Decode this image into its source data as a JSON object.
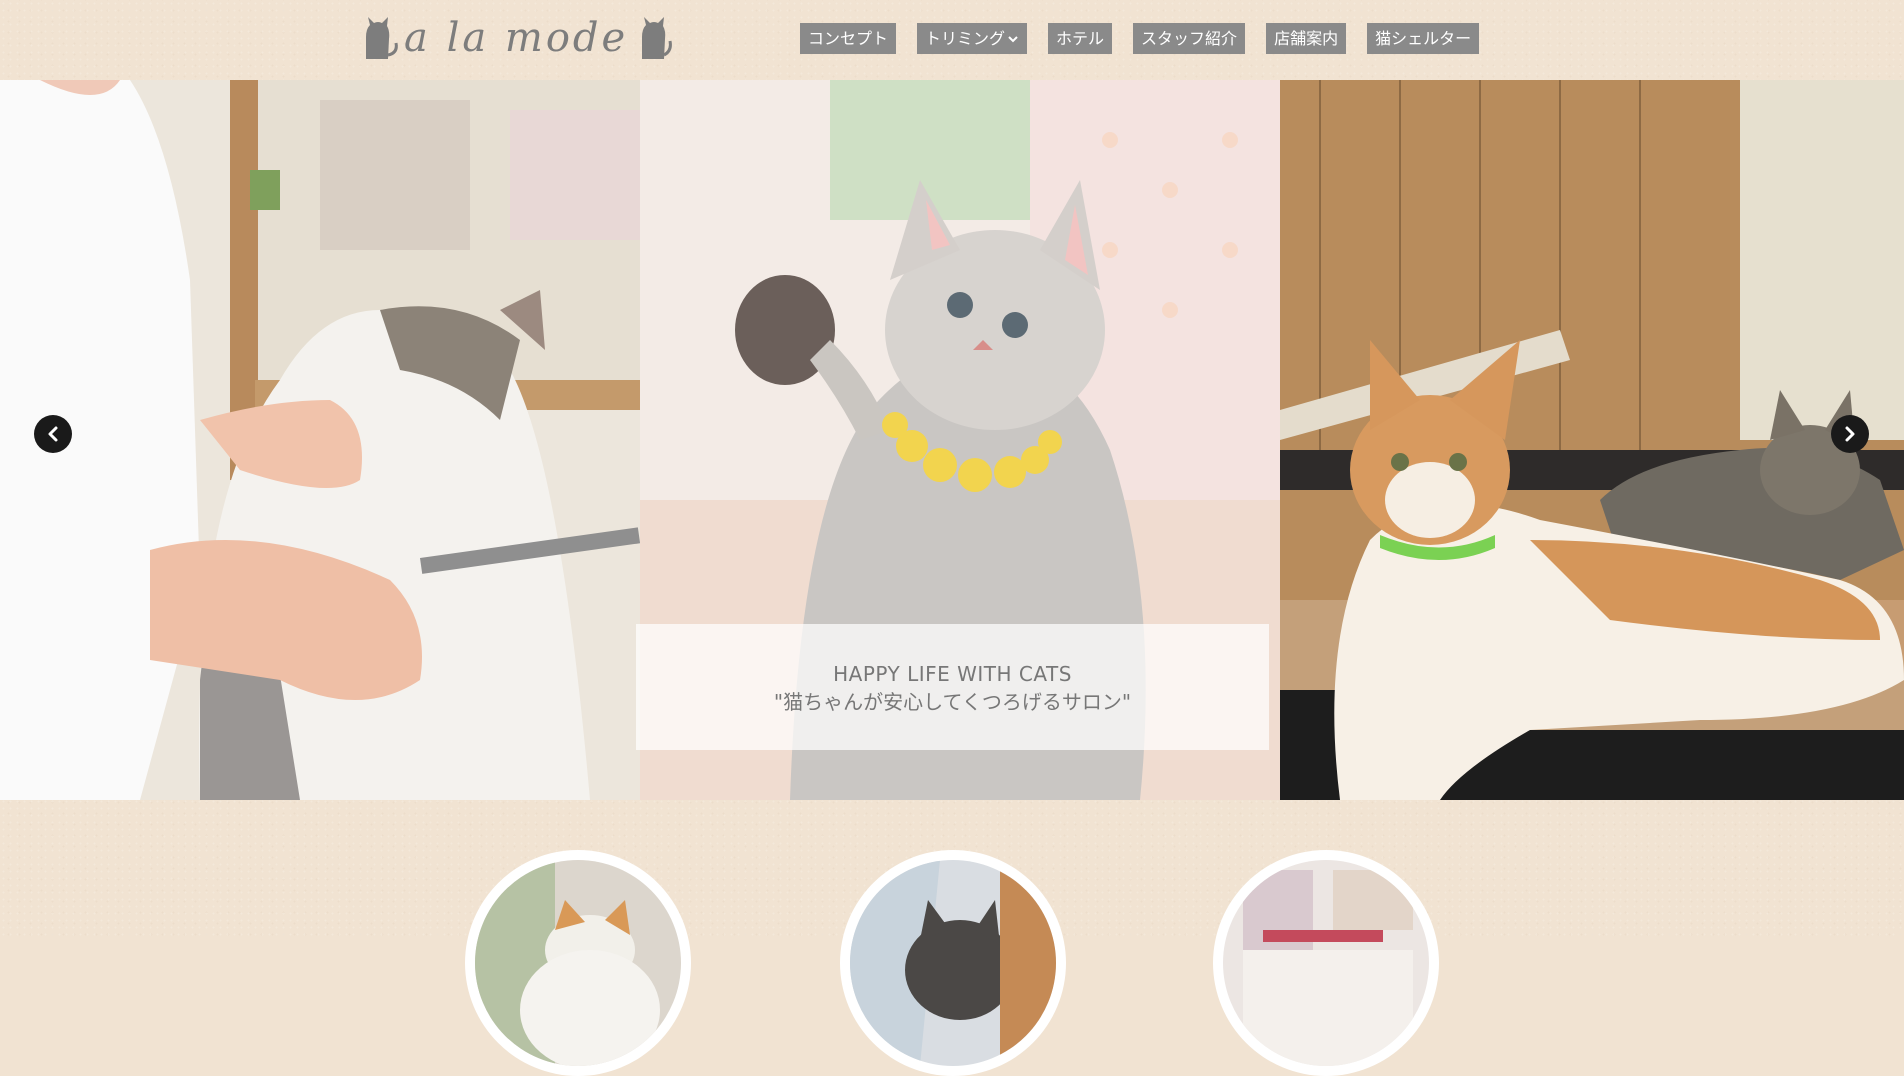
{
  "header": {
    "logo_text": "a la mode",
    "nav": [
      {
        "label": "コンセプト"
      },
      {
        "label": "トリミング",
        "has_dropdown": true
      },
      {
        "label": "ホテル"
      },
      {
        "label": "スタッフ紹介"
      },
      {
        "label": "店舗案内"
      },
      {
        "label": "猫シェルター"
      }
    ]
  },
  "slider": {
    "caption_title": "HAPPY LIFE WITH CATS",
    "caption_sub": "\"猫ちゃんが安心してくつろげるサロン\"",
    "prev_icon": "chevron-left-icon",
    "next_icon": "chevron-right-icon"
  },
  "features": [
    {
      "icon": "cat-photo"
    },
    {
      "icon": "cat-photo"
    },
    {
      "icon": "shop-photo"
    }
  ],
  "colors": {
    "background": "#f1e3d2",
    "nav_bg": "#8a8a8a",
    "nav_text": "#ffffff",
    "logo_text": "#7d7d7d",
    "caption_text": "#777777",
    "arrow_bg": "#1a1a1a"
  }
}
